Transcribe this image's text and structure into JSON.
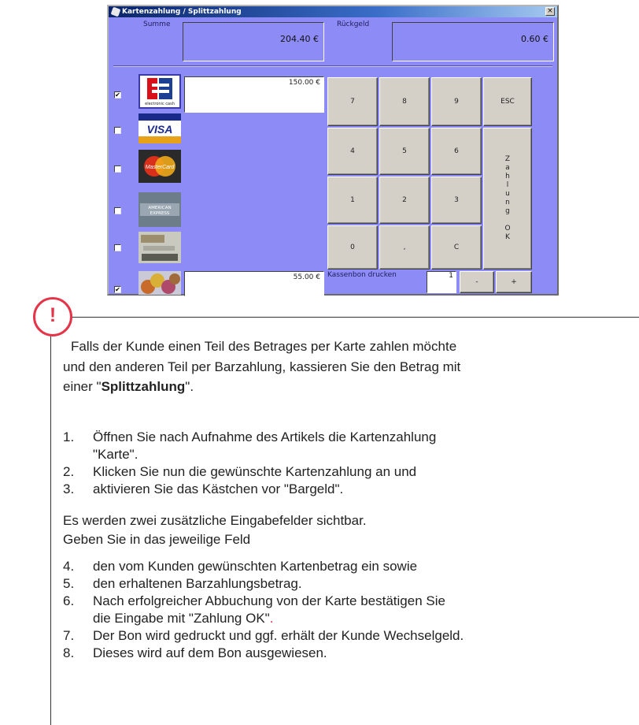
{
  "window": {
    "title": "Kartenzahlung / Splittzahlung",
    "close_glyph": "×",
    "summe_label": "Summe",
    "summe_value": "204.40 €",
    "rueckgeld_label": "Rückgeld",
    "rueckgeld_value": "0.60 €"
  },
  "payments": [
    {
      "name": "ec-card",
      "checked": true,
      "card_text": "electronic cash",
      "amount": "150.00 €"
    },
    {
      "name": "visa",
      "checked": false,
      "card_text": "VISA"
    },
    {
      "name": "mastercard",
      "checked": false,
      "card_text": "MasterCard"
    },
    {
      "name": "american-express",
      "checked": false,
      "card_text": "AMERICAN EXPRESS"
    },
    {
      "name": "other-card",
      "checked": false,
      "card_text": ""
    },
    {
      "name": "cash",
      "checked": true,
      "amount": "55.00 €"
    }
  ],
  "check_mark": "✔",
  "keypad": {
    "keys": [
      "7",
      "8",
      "9",
      "ESC",
      "4",
      "5",
      "6",
      "1",
      "2",
      "3",
      "0",
      ",",
      "C"
    ],
    "zahlung_letters": [
      "Z",
      "a",
      "h",
      "l",
      "u",
      "n",
      "g",
      "",
      "O",
      "K"
    ]
  },
  "receipt": {
    "label": "Kassenbon drucken",
    "count": "1",
    "minus": "-",
    "plus": "+"
  },
  "note": {
    "alert_symbol": "!",
    "intro_line1": "Falls der Kunde einen Teil des Betrages per Karte zahlen möchte",
    "intro_line2": "und den anderen Teil per Barzahlung, kassieren Sie den Betrag mit",
    "intro_line3_pre": "einer \"",
    "intro_line3_bold": "Splittzahlung",
    "intro_line3_post": "\".",
    "steps_a": [
      {
        "n": "1.",
        "lines": [
          "Öffnen Sie nach Aufnahme des Artikels die Kartenzahlung",
          "\"Karte\"."
        ]
      },
      {
        "n": "2.",
        "lines": [
          "Klicken Sie nun die gewünschte Kartenzahlung an und"
        ]
      },
      {
        "n": "3.",
        "lines": [
          "aktivieren Sie das Kästchen vor \"Bargeld\"."
        ]
      }
    ],
    "middle_line1": "Es werden zwei zusätzliche Eingabefelder sichtbar.",
    "middle_line2": "Geben Sie in das jeweilige Feld",
    "steps_b": [
      {
        "n": "4.",
        "lines": [
          "den vom Kunden gewünschten Kartenbetrag ein sowie"
        ]
      },
      {
        "n": "5.",
        "lines": [
          "den erhaltenen Barzahlungsbetrag."
        ]
      },
      {
        "n": "6.",
        "lines": [
          "Nach erfolgreicher Abbuchung von der Karte bestätigen Sie",
          "die Eingabe mit \"Zahlung OK\""
        ],
        "trailing_red": "."
      },
      {
        "n": "7.",
        "lines": [
          "Der Bon wird gedruckt und ggf. erhält der Kunde Wechselgeld."
        ]
      },
      {
        "n": "8.",
        "lines": [
          "Dieses wird auf dem Bon ausgewiesen."
        ]
      }
    ]
  }
}
